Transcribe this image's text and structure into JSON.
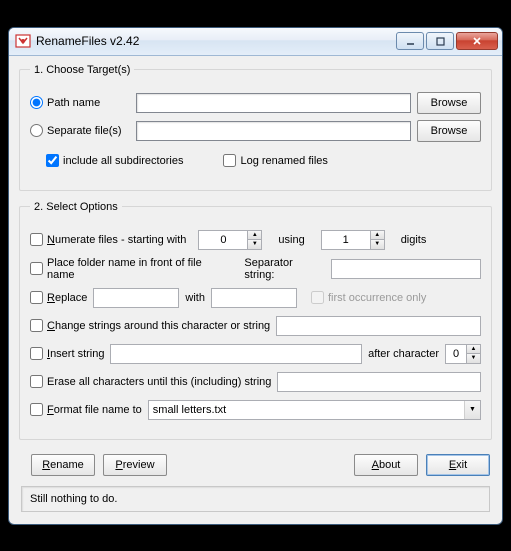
{
  "window": {
    "title": "RenameFiles v2.42"
  },
  "group1": {
    "legend": "1. Choose Target(s)",
    "path_label": "Path name",
    "path_value": "",
    "path_browse": "Browse",
    "separate_label": "Separate file(s)",
    "separate_value": "",
    "separate_browse": "Browse",
    "include_subdirs_label": "include all subdirectories",
    "include_subdirs_checked": true,
    "log_renamed_label": "Log renamed files",
    "log_renamed_checked": false,
    "selected_radio": "path"
  },
  "group2": {
    "legend": "2. Select Options",
    "numerate_label_pre": "umerate files - starting with",
    "numerate_start": "0",
    "numerate_mid": "using",
    "numerate_digits": "1",
    "numerate_suffix": "digits",
    "folder_prefix_label": "Place folder name in front of file name",
    "separator_label": "Separator string:",
    "separator_value": "",
    "replace_label": "eplace",
    "replace_from": "",
    "replace_with_label": "with",
    "replace_to": "",
    "first_occ_label": "first occurrence only",
    "change_strings_label": "hange strings around this character or string",
    "change_strings_value": "",
    "insert_label": "nsert string",
    "insert_value": "",
    "insert_after_label": "after character",
    "insert_after_pos": "0",
    "erase_label": "Erase all characters until this (including) string",
    "erase_value": "",
    "format_label": "ormat file name to",
    "format_value": "small letters.txt"
  },
  "buttons": {
    "rename": "ename",
    "preview": "review",
    "about": "bout",
    "exit": "xit"
  },
  "status": "Still nothing to do."
}
